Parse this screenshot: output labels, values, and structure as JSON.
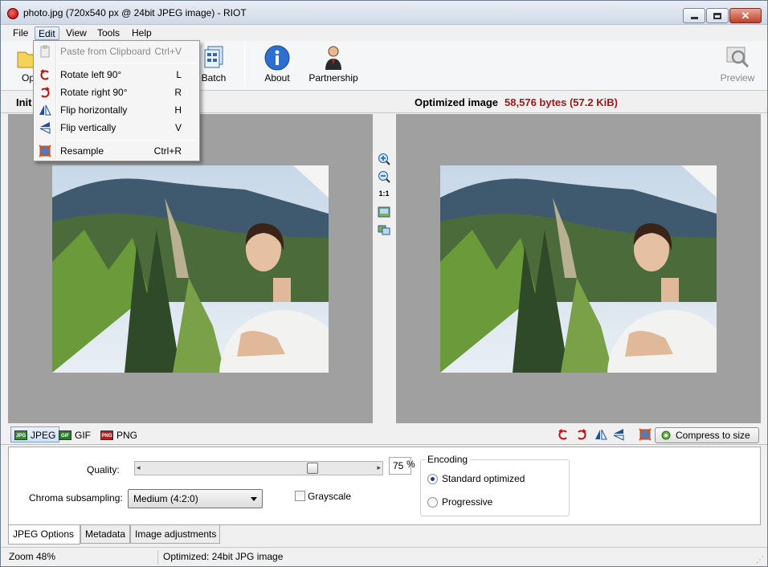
{
  "window": {
    "title": "photo.jpg (720x540 px @ 24bit JPEG image) - RIOT"
  },
  "menubar": {
    "items": [
      "File",
      "Edit",
      "View",
      "Tools",
      "Help"
    ],
    "active": "Edit"
  },
  "edit_menu": {
    "items": [
      {
        "label": "Paste from Clipboard",
        "shortcut": "Ctrl+V",
        "icon": "paste-icon",
        "disabled": true
      },
      {
        "label": "Rotate left 90°",
        "shortcut": "L",
        "icon": "rotate-left-icon"
      },
      {
        "label": "Rotate right 90°",
        "shortcut": "R",
        "icon": "rotate-right-icon"
      },
      {
        "label": "Flip horizontally",
        "shortcut": "H",
        "icon": "flip-horizontal-icon"
      },
      {
        "label": "Flip vertically",
        "shortcut": "V",
        "icon": "flip-vertical-icon"
      },
      {
        "label": "Resample",
        "shortcut": "Ctrl+R",
        "icon": "resample-icon"
      }
    ]
  },
  "toolbar": {
    "open_label": "Op",
    "batch_label": "Batch",
    "about_label": "About",
    "partnership_label": "Partnership",
    "preview_label": "Preview"
  },
  "header": {
    "initial_label": "Init",
    "initial_suffix": ")",
    "optimized_label": "Optimized image",
    "optimized_size": "58,576 bytes (57.2 KiB)"
  },
  "midbar": {
    "actual_size": "1:1"
  },
  "format_tabs": [
    "JPEG",
    "GIF",
    "PNG"
  ],
  "compress_label": "Compress to size",
  "options": {
    "quality_label": "Quality:",
    "quality_value": "75",
    "quality_unit": "%",
    "quality_fraction": 0.75,
    "chroma_label": "Chroma subsampling:",
    "chroma_value": "Medium (4:2:0)",
    "grayscale_label": "Grayscale",
    "encoding_legend": "Encoding",
    "encoding_options": [
      "Standard optimized",
      "Progressive"
    ],
    "encoding_selected": "Standard optimized"
  },
  "bottom_tabs": [
    "JPEG Options",
    "Metadata",
    "Image adjustments"
  ],
  "status": {
    "zoom": "Zoom 48%",
    "info": "Optimized: 24bit JPG image"
  }
}
